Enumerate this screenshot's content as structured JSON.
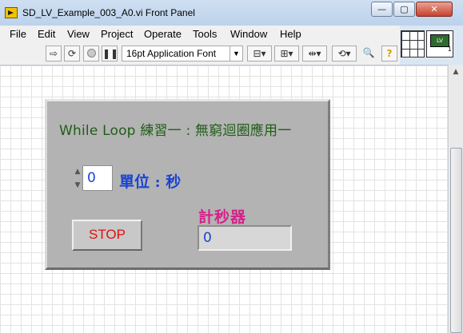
{
  "window": {
    "title": "SD_LV_Example_003_A0.vi Front Panel",
    "controls": {
      "minimize": "—",
      "maximize": "▢",
      "close": "✕"
    }
  },
  "menu": {
    "items": [
      "File",
      "Edit",
      "View",
      "Project",
      "Operate",
      "Tools",
      "Window",
      "Help"
    ]
  },
  "toolbar": {
    "font": "16pt Application Font",
    "icons": [
      "run-arrow-icon",
      "run-continuous-icon",
      "abort-icon",
      "pause-icon",
      "align-objects-icon",
      "distribute-objects-icon",
      "resize-objects-icon",
      "reorder-icon",
      "search-icon",
      "help-icon"
    ]
  },
  "vi_icon": {
    "number": "1"
  },
  "panel": {
    "title": "While Loop 練習一 : 無窮迴圈應用一",
    "numeric_value": "0",
    "unit_label": "單位 : 秒",
    "stop_label": "STOP",
    "timer_label": "計秒器",
    "timer_value": "0"
  },
  "colors": {
    "title_green": "#1f5e16",
    "value_blue": "#1a43d6",
    "stop_red": "#e01010",
    "timer_magenta": "#d6208a",
    "panel_gray": "#b3b3b3"
  }
}
